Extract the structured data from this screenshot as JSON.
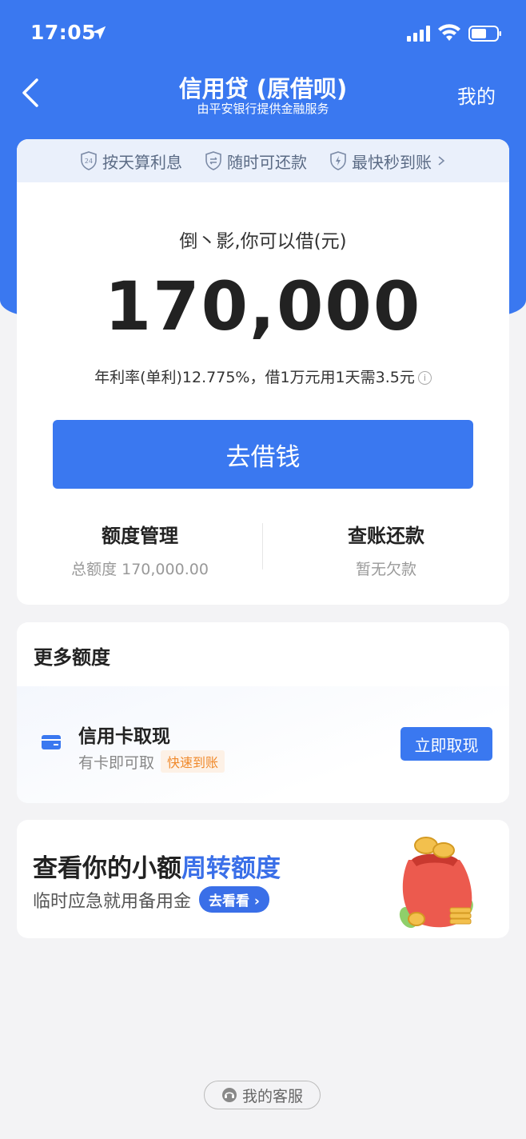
{
  "status_bar": {
    "time": "17:05"
  },
  "nav": {
    "title": "信用贷 (原借呗)",
    "subtitle": "由平安银行提供金融服务",
    "mine": "我的"
  },
  "features": [
    {
      "icon": "clock-24-shield-icon",
      "label": "按天算利息"
    },
    {
      "icon": "swap-shield-icon",
      "label": "随时可还款"
    },
    {
      "icon": "lightning-shield-icon",
      "label": "最快秒到账"
    }
  ],
  "loan": {
    "greeting": "倒丶影,你可以借(元)",
    "amount": "170,000",
    "rate_text": "年利率(单利)12.775%，借1万元用1天需3.5元",
    "borrow_button": "去借钱"
  },
  "stats": {
    "left_title": "额度管理",
    "left_sub": "总额度 170,000.00",
    "right_title": "查账还款",
    "right_sub": "暂无欠款"
  },
  "more": {
    "title": "更多额度",
    "item_title": "信用卡取现",
    "item_sub": "有卡即可取",
    "item_badge": "快速到账",
    "item_button": "立即取现"
  },
  "promo": {
    "title_part1": "查看你的小额",
    "title_highlight": "周转额度",
    "subtitle": "临时应急就用备用金",
    "button": "去看看"
  },
  "service": {
    "label": "我的客服"
  },
  "colors": {
    "brand_blue": "#3a78f0",
    "badge_orange": "#f08a2c",
    "background": "#f3f3f5"
  }
}
